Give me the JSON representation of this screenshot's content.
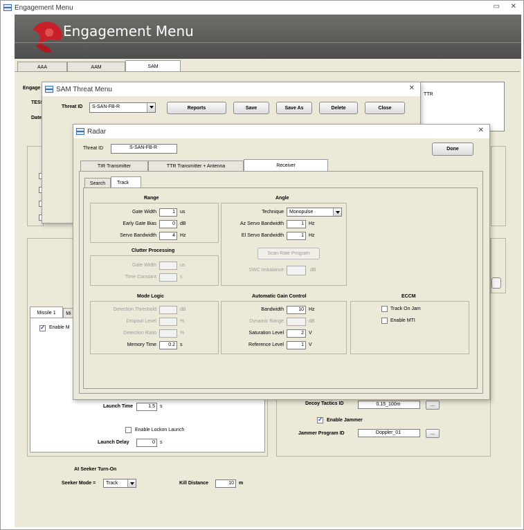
{
  "main": {
    "title": "Engagement Menu",
    "header_title": "Engagement Menu",
    "tabs": [
      "AAA",
      "AAM",
      "SAM"
    ],
    "truncated": {
      "engage": "Engage",
      "tess": "TESS",
      "date": "Date",
      "ttr": "TTR",
      "decoy": "Decoy Tactics ID",
      "decoy_value": "0.15_100m"
    },
    "missile_tabs": [
      "Missile 1",
      "Mi"
    ],
    "enable_m": "Enable M",
    "launch_time_label": "Launch Time",
    "launch_time_value": "1.5",
    "launch_time_unit": "s",
    "enable_lockon_label": "Enable Lockon Launch",
    "launch_delay_label": "Launch Delay",
    "launch_delay_value": "0",
    "launch_delay_unit": "s",
    "enable_jammer_label": "Enable Jammer",
    "jammer_program_label": "Jammer Program ID",
    "jammer_program_value": "Doppler_01",
    "ellipsis": "...",
    "seeker_heading": "At Seeker Turn-On",
    "seeker_mode_label": "Seeker Mode =",
    "seeker_mode_value": "Track",
    "kill_distance_label": "Kill Distance",
    "kill_distance_value": "10",
    "kill_distance_unit": "m"
  },
  "sam_menu": {
    "title": "SAM Threat Menu",
    "threat_id_label": "Threat ID",
    "threat_id_value": "S-SAN-FB-R",
    "buttons": {
      "reports": "Reports",
      "save": "Save",
      "save_as": "Save As",
      "delete": "Delete",
      "close": "Close"
    }
  },
  "radar": {
    "title": "Radar",
    "threat_id_label": "Threat ID",
    "threat_id_value": "S-SAN-FB-R",
    "done": "Done",
    "tabs": [
      "TIR Transmitter",
      "TTR Transmitter + Antenna",
      "Receiver"
    ],
    "subtabs": [
      "Search",
      "Track"
    ],
    "range": {
      "heading": "Range",
      "gate_width_label": "Gate Width",
      "gate_width_value": "1",
      "gate_width_unit": "us",
      "early_gate_label": "Early Gate Bias",
      "early_gate_value": "0",
      "early_gate_unit": "dB",
      "servo_label": "Servo Bandwidth",
      "servo_value": "4",
      "servo_unit": "Hz"
    },
    "angle": {
      "heading": "Angle",
      "technique_label": "Technique",
      "technique_value": "Monopulse",
      "az_label": "Az Servo Bandwidth",
      "az_value": "1",
      "az_unit": "Hz",
      "el_label": "El Servo Bandwidth",
      "el_value": "1",
      "el_unit": "Hz",
      "scan_rate_button": "Scan Rate Program",
      "swc_label": "SWC Imbalance",
      "swc_unit": "dB"
    },
    "clutter": {
      "heading": "Clutter Processing",
      "gate_width_label": "Gate Width",
      "gate_width_unit": "us",
      "time_constant_label": "Time Constant",
      "time_constant_unit": "s"
    },
    "mode_logic": {
      "heading": "Mode Logic",
      "detection_threshold_label": "Detection Threshold",
      "detection_threshold_unit": "dB",
      "dropout_label": "Dropout Level",
      "dropout_unit": "%",
      "detection_ratio_label": "Detection Ratio",
      "detection_ratio_unit": "%",
      "memory_label": "Memory Time",
      "memory_value": "0.2",
      "memory_unit": "s"
    },
    "agc": {
      "heading": "Automatic Gain Control",
      "bandwidth_label": "Bandwidth",
      "bandwidth_value": "10",
      "bandwidth_unit": "Hz",
      "dynamic_label": "Dynamic Range",
      "dynamic_unit": "dB",
      "saturation_label": "Saturation Level",
      "saturation_value": "2",
      "saturation_unit": "V",
      "reference_label": "Reference Level",
      "reference_value": "1",
      "reference_unit": "V"
    },
    "eccm": {
      "heading": "ECCM",
      "track_on_jam": "Track On Jam",
      "enable_mti": "Enable MTI"
    }
  },
  "colors": {
    "header_bg": "#5a5a58",
    "panel_bg": "#ece9d8",
    "accent_red": "#c8202a"
  }
}
